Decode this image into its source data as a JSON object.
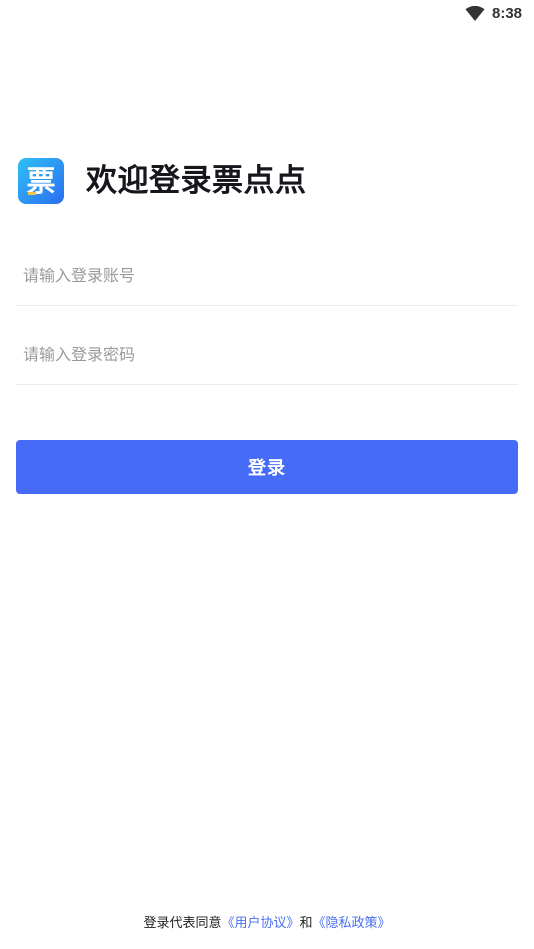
{
  "status_bar": {
    "time": "8:38",
    "wifi_icon": "wifi-icon"
  },
  "header": {
    "logo_icon": "app-logo-icon",
    "logo_glyph": "票",
    "title": "欢迎登录票点点"
  },
  "form": {
    "account_placeholder": "请输入登录账号",
    "account_value": "",
    "password_placeholder": "请输入登录密码",
    "password_value": "",
    "login_label": "登录"
  },
  "agreement": {
    "prefix": "登录代表同意",
    "user_agreement": "《用户协议》",
    "conjunction": "和",
    "privacy_policy": "《隐私政策》"
  },
  "colors": {
    "accent": "#466cf7",
    "link": "#4a6ff2",
    "title": "#15171c",
    "placeholder": "#9a9a9a"
  }
}
